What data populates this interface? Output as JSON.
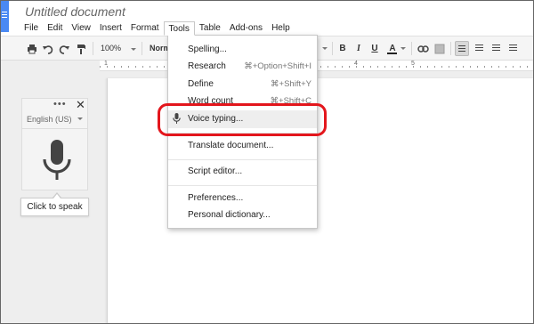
{
  "document": {
    "title": "Untitled document"
  },
  "menubar": {
    "items": [
      "File",
      "Edit",
      "View",
      "Insert",
      "Format",
      "Tools",
      "Table",
      "Add-ons",
      "Help"
    ],
    "active": "Tools"
  },
  "toolbar": {
    "zoom": "100%",
    "style": "Norm"
  },
  "ruler": {
    "marks": [
      "1",
      "3",
      "4",
      "5"
    ]
  },
  "tools_menu": {
    "spelling": "Spelling...",
    "research": {
      "label": "Research",
      "shortcut": "⌘+Option+Shift+I"
    },
    "define": {
      "label": "Define",
      "shortcut": "⌘+Shift+Y"
    },
    "word_count": {
      "label": "Word count",
      "shortcut": "⌘+Shift+C"
    },
    "voice_typing": "Voice typing...",
    "translate": "Translate document...",
    "script_editor": "Script editor...",
    "preferences": "Preferences...",
    "personal_dictionary": "Personal dictionary..."
  },
  "voice_panel": {
    "dots": "•••",
    "close": "✕",
    "language": "English (US)",
    "tooltip": "Click to speak"
  },
  "colors": {
    "highlight_ring": "#e3161c",
    "doc_icon": "#4a89f3",
    "mic": "#444444"
  },
  "icons": [
    "doc-icon",
    "print-icon",
    "undo-icon",
    "redo-icon",
    "paint-format-icon",
    "link-icon",
    "comment-icon",
    "text-color-icon",
    "align-left-icon",
    "align-center-icon",
    "align-right-icon",
    "justify-icon",
    "mic-icon",
    "close-icon",
    "more-icon",
    "dropdown-caret-icon"
  ]
}
